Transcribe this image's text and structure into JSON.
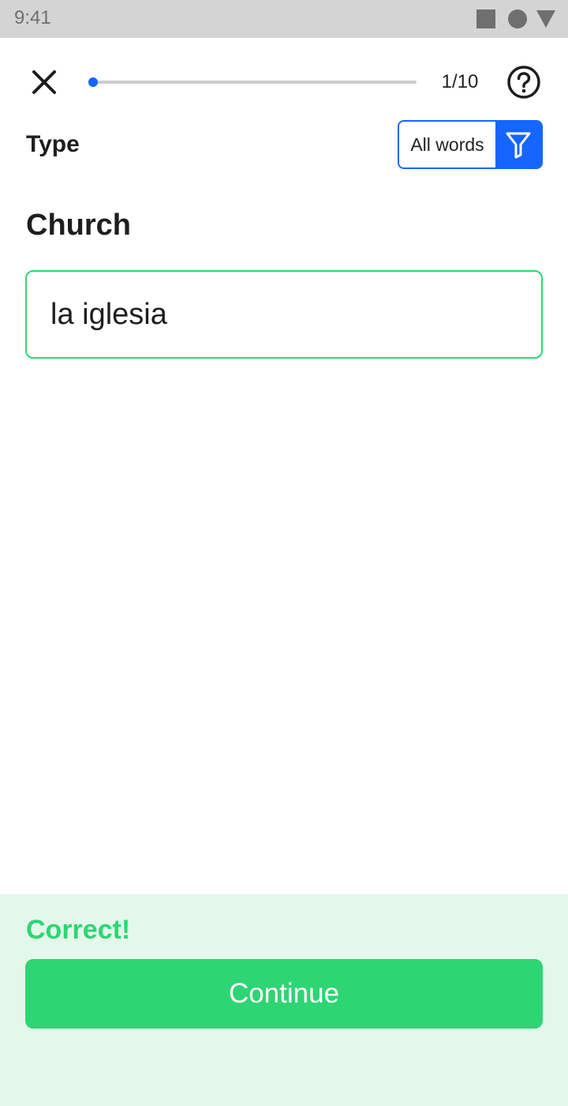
{
  "status_bar": {
    "time": "9:41",
    "icons": [
      "square-icon",
      "circle-icon",
      "triangle-icon"
    ]
  },
  "top_bar": {
    "close_icon": "close-icon",
    "progress": {
      "current": 1,
      "total": 10,
      "label": "1/10"
    },
    "help_icon": "question-circle-icon"
  },
  "exercise": {
    "mode_label": "Type",
    "filter": {
      "selected": "All words",
      "icon": "filter-icon"
    },
    "prompt": "Church",
    "answer": {
      "value": "la iglesia",
      "placeholder": ""
    }
  },
  "feedback": {
    "title": "Correct!",
    "continue_label": "Continue"
  },
  "colors": {
    "accent": "#1565ff",
    "success": "#2ed573",
    "success_bg": "#e3f7ea",
    "status_bar_bg": "#d4d4d4"
  }
}
